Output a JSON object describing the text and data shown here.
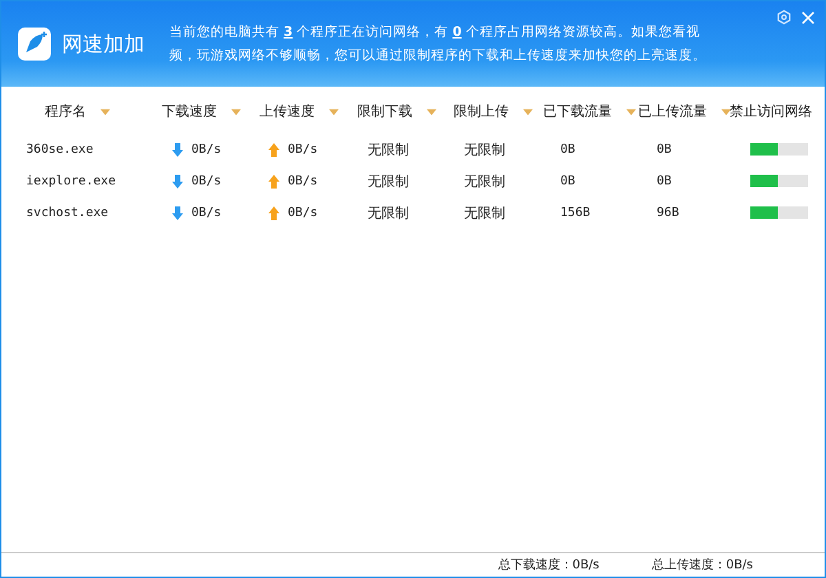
{
  "window": {
    "title": "网速加加"
  },
  "notice": "当前您的电脑共有 **3** 个程序正在访问网络，有 **0** 个程序占用网络资源较高。如果您看视频，玩游戏网络不够顺畅，您可以通过限制程序的下载和上传速度来加快您的上亮速度。",
  "table": {
    "columns": [
      "程序名",
      "下载速度",
      "上传速度",
      "限制下载",
      "限制上传",
      "已下载流量",
      "已上传流量",
      "禁止访问网络"
    ],
    "rows": [
      {
        "name": "360se.exe",
        "down": "0B/s",
        "up": "0B/s",
        "limit_down": "无限制",
        "limit_up": "无限制",
        "downloaded": "0B",
        "uploaded": "0B",
        "on": true
      },
      {
        "name": "iexplore.exe",
        "down": "0B/s",
        "up": "0B/s",
        "limit_down": "无限制",
        "limit_up": "无限制",
        "downloaded": "0B",
        "uploaded": "0B",
        "on": true
      },
      {
        "name": "svchost.exe",
        "down": "0B/s",
        "up": "0B/s",
        "limit_down": "无限制",
        "limit_up": "无限制",
        "downloaded": "156B",
        "uploaded": "96B",
        "on": true
      }
    ]
  },
  "status_bar": {
    "total_down": "总下载速度：0B/s",
    "total_up": "总上传速度：0B/s"
  }
}
